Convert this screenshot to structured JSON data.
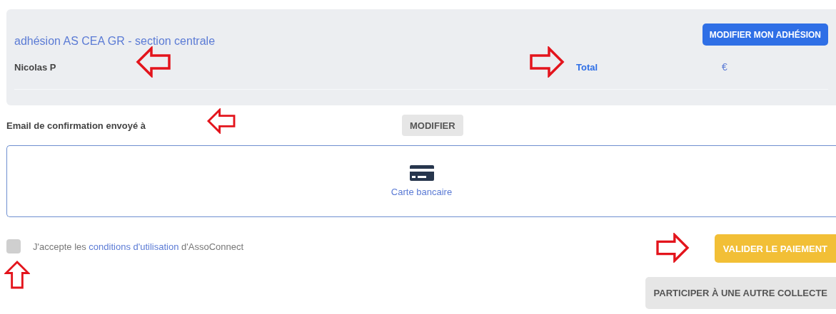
{
  "summary": {
    "title": "adhésion AS CEA GR - section centrale",
    "edit_button": "MODIFIER MON ADHÉSION",
    "name": "Nicolas P",
    "name_annotated": true,
    "total_label": "Total",
    "total_annotated": true,
    "total_value": "€"
  },
  "email": {
    "label": "Email de confirmation envoyé à",
    "label_annotated": true,
    "modify_button": "MODIFIER"
  },
  "payment_methods": [
    {
      "label": "Carte bancaire",
      "selected": true
    }
  ],
  "terms": {
    "checked": false,
    "annotated": true,
    "before": "J'accepte les ",
    "link": "conditions d'utilisation",
    "after": " d'AssoConnect"
  },
  "actions": [
    {
      "label": "VALIDER LE PAIEMENT",
      "kind": "primary",
      "annotated": true
    },
    {
      "label": "PARTICIPER À UNE AUTRE COLLECTE",
      "kind": "secondary"
    }
  ]
}
